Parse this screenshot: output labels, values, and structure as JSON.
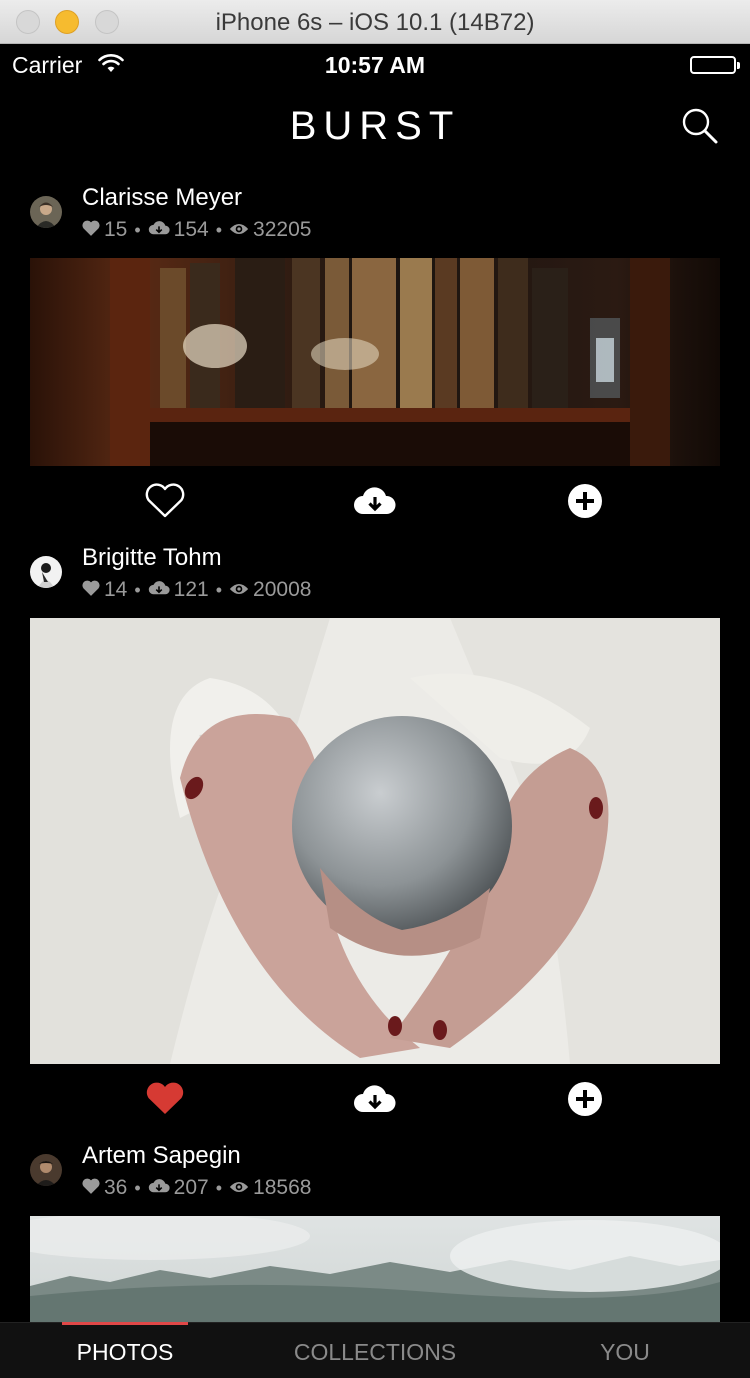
{
  "window": {
    "title": "iPhone 6s – iOS 10.1 (14B72)"
  },
  "status_bar": {
    "carrier": "Carrier",
    "time": "10:57 AM"
  },
  "app": {
    "brand": "BURST"
  },
  "posts": [
    {
      "author": "Clarisse Meyer",
      "likes": "15",
      "downloads": "154",
      "views": "32205",
      "liked": false
    },
    {
      "author": "Brigitte Tohm",
      "likes": "14",
      "downloads": "121",
      "views": "20008",
      "liked": true
    },
    {
      "author": "Artem Sapegin",
      "likes": "36",
      "downloads": "207",
      "views": "18568",
      "liked": false
    }
  ],
  "tabs": [
    {
      "label": "PHOTOS",
      "active": true
    },
    {
      "label": "COLLECTIONS",
      "active": false
    },
    {
      "label": "YOU",
      "active": false
    }
  ],
  "colors": {
    "background": "#000000",
    "accent": "#e04848",
    "liked_heart": "#d63a33",
    "muted_text": "#9a9a9a"
  }
}
